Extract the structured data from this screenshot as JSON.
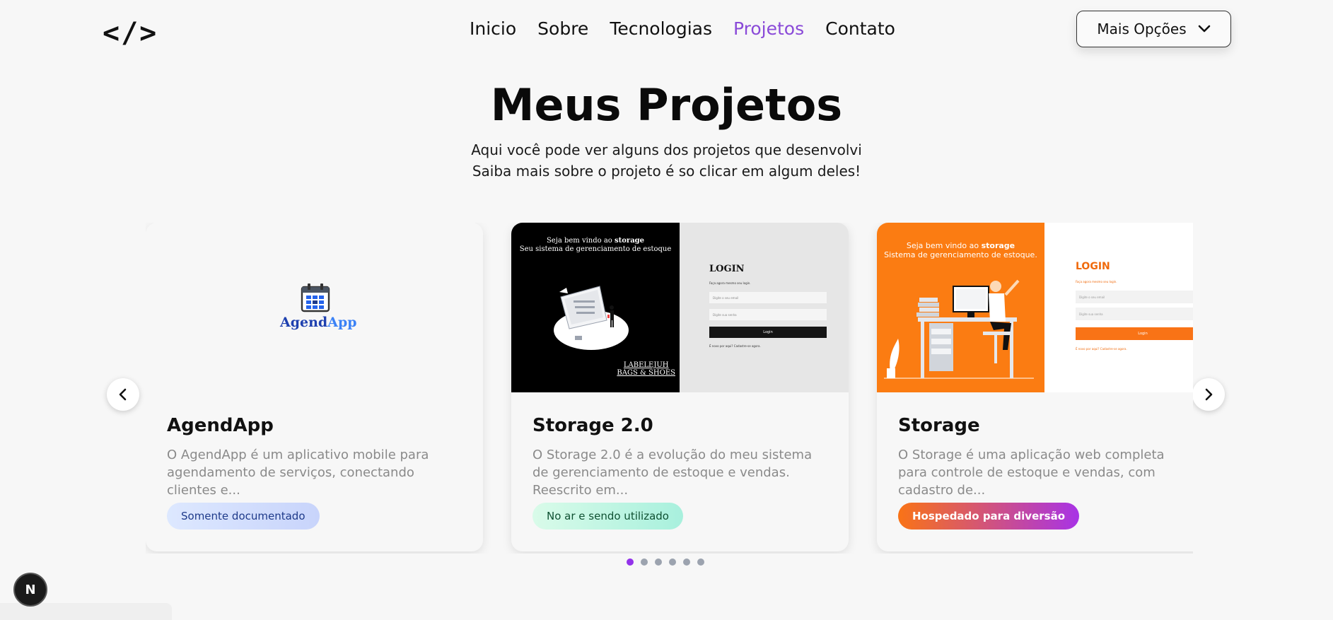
{
  "header": {
    "logo": "</>",
    "nav": [
      "Inicio",
      "Sobre",
      "Tecnologias",
      "Projetos",
      "Contato"
    ],
    "active_nav": "Projetos",
    "more_button": "Mais Opções",
    "accent_color": "#8a4ad8"
  },
  "hero": {
    "title": "Meus Projetos",
    "subtitle_line1": "Aqui você pode ver alguns dos projetos que desenvolvi",
    "subtitle_line2": "Saiba mais sobre o projeto é so clicar em algum deles!"
  },
  "projects": [
    {
      "title": "AgendApp",
      "desc": "O AgendApp é um aplicativo mobile para agendamento de serviços, conectando clientes e...",
      "badge": "Somente documentado",
      "logo_text_a": "Agend",
      "logo_text_b": "App"
    },
    {
      "title": "Storage 2.0",
      "desc": "O Storage 2.0 é a evolução do meu sistema de gerenciamento de estoque e vendas. Reescrito em...",
      "badge": "No ar e sendo utilizado",
      "shot": {
        "welcome_a": "Seja bem vindo ao ",
        "welcome_b": "storage",
        "welcome_line2": "Seu sistema de gerenciamento de estoque",
        "brand_line1": "LABELEJUH",
        "brand_line2": "BAGS & SHOES",
        "login_title": "LOGIN",
        "login_hint": "Faça agora mesmo seu login.",
        "email_placeholder": "Digite o seu email",
        "password_placeholder": "Digite sua senha",
        "login_button": "Login",
        "signup": "É novo por aqui? Cadastre-se agora."
      }
    },
    {
      "title": "Storage",
      "desc": "O Storage é uma aplicação web completa para controle de estoque e vendas, com cadastro de...",
      "badge": "Hospedado para diversão",
      "shot": {
        "welcome_a": "Seja bem vindo ao ",
        "welcome_b": "storage",
        "welcome_line2": "Sistema de gerenciamento de estoque.",
        "login_title": "LOGIN",
        "login_hint": "Faça agora mesmo seu login.",
        "email_placeholder": "Digite o seu email",
        "password_placeholder": "Digite sua senha",
        "login_button": "Login",
        "signup": "É novo por aqui? Cadastre-se agora."
      }
    }
  ],
  "pagination": {
    "total": 6,
    "current": 1
  },
  "dev_badge": "N"
}
